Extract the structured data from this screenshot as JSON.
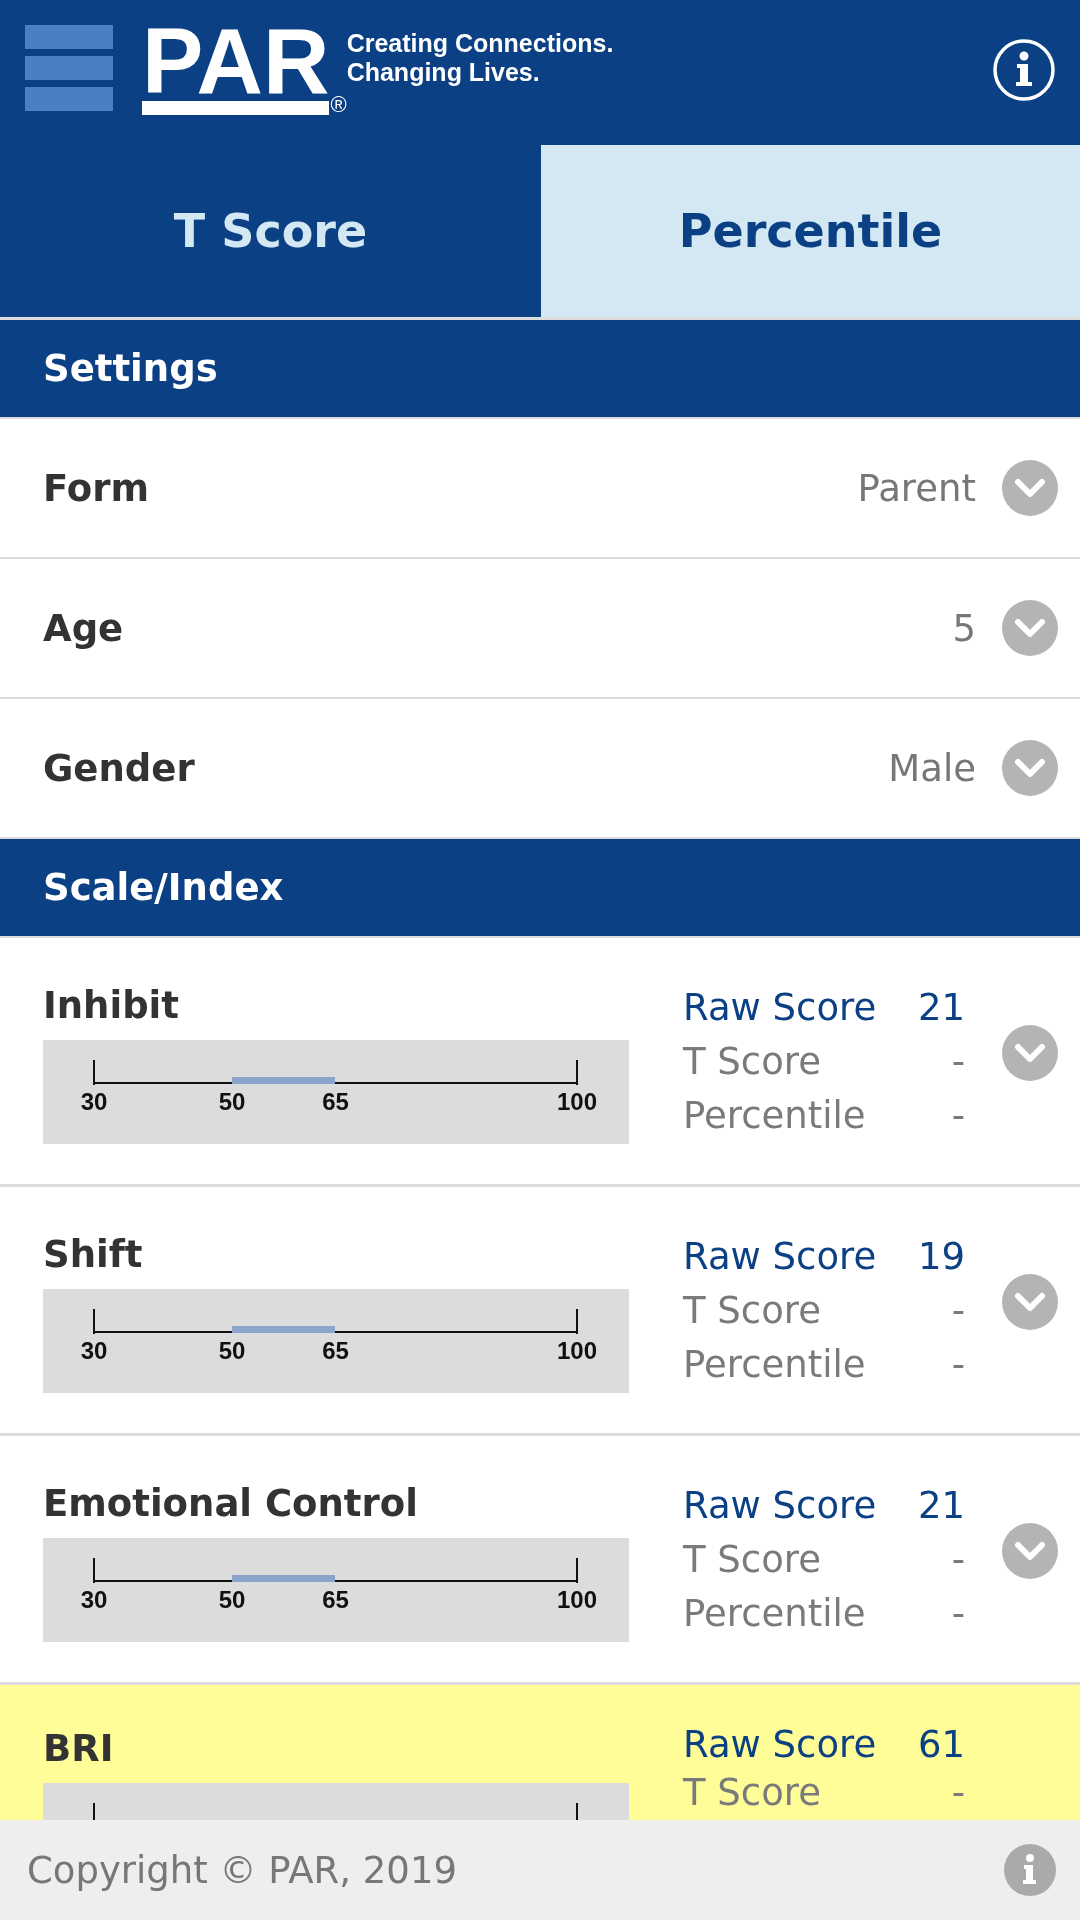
{
  "header": {
    "logo": {
      "wordmark": "PAR",
      "registered": "®",
      "tagline": [
        "Creating Connections.",
        "Changing Lives."
      ]
    }
  },
  "tabs": [
    {
      "label": "T Score",
      "selected": false
    },
    {
      "label": "Percentile",
      "selected": true
    }
  ],
  "settings": {
    "title": "Settings",
    "fields": [
      {
        "label": "Form",
        "value": "Parent"
      },
      {
        "label": "Age",
        "value": "5"
      },
      {
        "label": "Gender",
        "value": "Male"
      }
    ]
  },
  "scales": {
    "title": "Scale/Index",
    "rows": [
      {
        "name": "Inhibit",
        "kind": "scale",
        "gauge": {
          "ticks": [
            {
              "label": "30",
              "kind": "end",
              "level": 0
            },
            {
              "label": "50",
              "kind": "band",
              "level": 0.286
            },
            {
              "label": "65",
              "kind": "band",
              "level": 0.5
            },
            {
              "label": "100",
              "kind": "end",
              "level": 1
            }
          ]
        },
        "scores": [
          {
            "label": "Raw Score",
            "value": "21",
            "kind": "raw"
          },
          {
            "label": "T Score",
            "value": "-",
            "kind": "derived"
          },
          {
            "label": "Percentile",
            "value": "-",
            "kind": "derived"
          }
        ]
      },
      {
        "name": "Shift",
        "kind": "scale",
        "gauge": {
          "ticks": [
            {
              "label": "30",
              "kind": "end",
              "level": 0
            },
            {
              "label": "50",
              "kind": "band",
              "level": 0.286
            },
            {
              "label": "65",
              "kind": "band",
              "level": 0.5
            },
            {
              "label": "100",
              "kind": "end",
              "level": 1
            }
          ]
        },
        "scores": [
          {
            "label": "Raw Score",
            "value": "19",
            "kind": "raw"
          },
          {
            "label": "T Score",
            "value": "-",
            "kind": "derived"
          },
          {
            "label": "Percentile",
            "value": "-",
            "kind": "derived"
          }
        ]
      },
      {
        "name": "Emotional Control",
        "kind": "scale",
        "gauge": {
          "ticks": [
            {
              "label": "30",
              "kind": "end",
              "level": 0
            },
            {
              "label": "50",
              "kind": "band",
              "level": 0.286
            },
            {
              "label": "65",
              "kind": "band",
              "level": 0.5
            },
            {
              "label": "100",
              "kind": "end",
              "level": 1
            }
          ]
        },
        "scores": [
          {
            "label": "Raw Score",
            "value": "21",
            "kind": "raw"
          },
          {
            "label": "T Score",
            "value": "-",
            "kind": "derived"
          },
          {
            "label": "Percentile",
            "value": "-",
            "kind": "derived"
          }
        ]
      },
      {
        "name": "BRI",
        "kind": "index",
        "gauge": {
          "ticks": [
            {
              "kind": "end",
              "level": 0
            },
            {
              "kind": "end",
              "level": 1
            }
          ]
        },
        "scores": [
          {
            "label": "Raw Score",
            "value": "61",
            "kind": "raw"
          },
          {
            "label": "T Score",
            "value": "-",
            "kind": "derived"
          }
        ]
      }
    ]
  },
  "footer": {
    "copyright": "Copyright © PAR, 2019"
  }
}
